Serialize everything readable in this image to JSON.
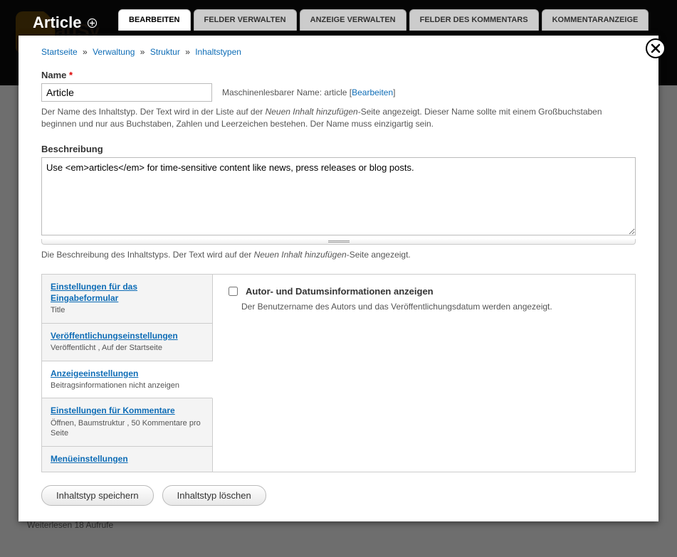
{
  "bg": {
    "logo_text": "TauSy",
    "weiterlesen": "Weiterlesen   18 Aufrufe"
  },
  "title": "Article",
  "tabs": {
    "edit": "BEARBEITEN",
    "fields": "FELDER VERWALTEN",
    "display": "ANZEIGE VERWALTEN",
    "comment_fields": "FELDER DES KOMMENTARS",
    "comment_display": "KOMMENTARANZEIGE"
  },
  "breadcrumb": {
    "home": "Startseite",
    "admin": "Verwaltung",
    "structure": "Struktur",
    "types": "Inhaltstypen"
  },
  "name": {
    "label": "Name",
    "value": "Article",
    "machine_prefix": "Maschinenlesbarer Name: ",
    "machine_value": "article",
    "edit_link": "Bearbeiten",
    "help": "Der Name des Inhaltstyp. Der Text wird in der Liste auf der Neuen Inhalt hinzufügen-Seite angezeigt. Dieser Name sollte mit einem Großbuchstaben beginnen und nur aus Buchstaben, Zahlen und Leerzeichen bestehen. Der Name muss einzigartig sein.",
    "help_em": "Neuen Inhalt hinzufügen"
  },
  "description": {
    "label": "Beschreibung",
    "value": "Use <em>articles</em> for time-sensitive content like news, press releases or blog posts.",
    "help": "Die Beschreibung des Inhaltstyps. Der Text wird auf der Neuen Inhalt hinzufügen-Seite angezeigt.",
    "help_em": "Neuen Inhalt hinzufügen"
  },
  "vtabs": [
    {
      "title": "Einstellungen für das Eingabeformular",
      "summary": "Title"
    },
    {
      "title": "Veröffentlichungseinstellungen",
      "summary": "Veröffentlicht , Auf der Startseite"
    },
    {
      "title": "Anzeigeeinstellungen",
      "summary": "Beitragsinformationen nicht anzeigen"
    },
    {
      "title": "Einstellungen für Kommentare",
      "summary": "Öffnen, Baumstruktur , 50 Kommentare pro Seite"
    },
    {
      "title": "Menüeinstellungen",
      "summary": ""
    }
  ],
  "display_settings": {
    "checkbox_label": "Autor- und Datumsinformationen anzeigen",
    "checkbox_desc": "Der Benutzername des Autors und das Veröffentlichungsdatum werden angezeigt."
  },
  "buttons": {
    "save": "Inhaltstyp speichern",
    "delete": "Inhaltstyp löschen"
  }
}
